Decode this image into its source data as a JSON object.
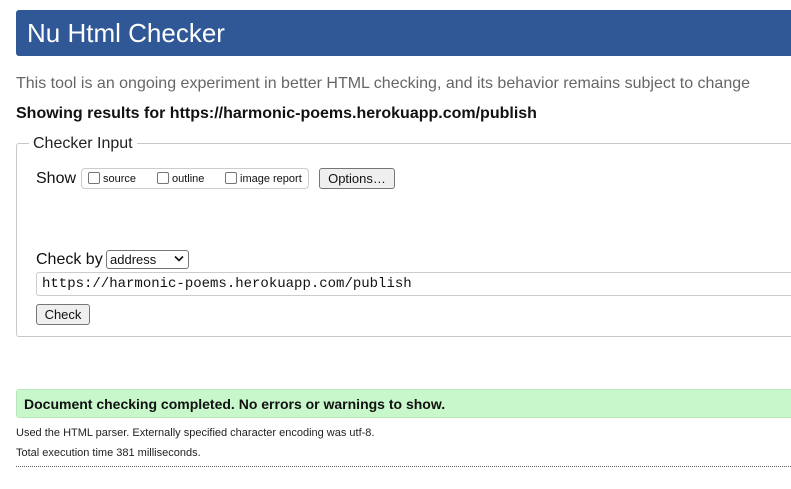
{
  "header": {
    "title": "Nu Html Checker"
  },
  "intro": "This tool is an ongoing experiment in better HTML checking, and its behavior remains subject to change",
  "results_for": "Showing results for https://harmonic-poems.herokuapp.com/publish",
  "checker_input": {
    "legend": "Checker Input",
    "show_label": "Show",
    "options": [
      {
        "label": "source",
        "checked": false
      },
      {
        "label": "outline",
        "checked": false
      },
      {
        "label": "image report",
        "checked": false
      }
    ],
    "options_button": "Options…",
    "check_by_label": "Check by",
    "check_by_value": "address",
    "url_value": "https://harmonic-poems.herokuapp.com/publish",
    "check_button": "Check"
  },
  "result": {
    "success_message": "Document checking completed. No errors or warnings to show.",
    "parser_info": "Used the HTML parser. Externally specified character encoding was utf-8.",
    "execution_time": "Total execution time 381 milliseconds."
  },
  "colors": {
    "header_bg": "#305896",
    "success_bg": "#c7f7cb"
  }
}
